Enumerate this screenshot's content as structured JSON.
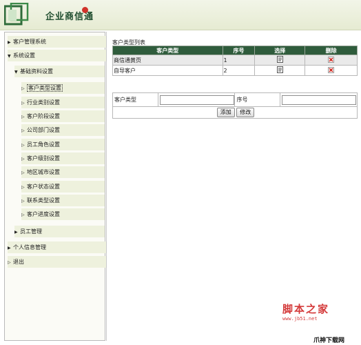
{
  "app": {
    "title": "企业商信通"
  },
  "sidebar": {
    "items": [
      {
        "label": "客户管理系统",
        "level": 0,
        "expanded": false
      },
      {
        "label": "系统设置",
        "level": 0,
        "expanded": true
      },
      {
        "label": "基础资料设置",
        "level": 1,
        "expanded": true
      },
      {
        "label": "客户类型设置",
        "level": 2,
        "selected": true
      },
      {
        "label": "行业类别设置",
        "level": 2
      },
      {
        "label": "客户阶段设置",
        "level": 2
      },
      {
        "label": "公司部门设置",
        "level": 2
      },
      {
        "label": "员工角色设置",
        "level": 2
      },
      {
        "label": "客户级别设置",
        "level": 2
      },
      {
        "label": "地区城市设置",
        "level": 2
      },
      {
        "label": "客户状态设置",
        "level": 2
      },
      {
        "label": "联系类型设置",
        "level": 2
      },
      {
        "label": "客户进度设置",
        "level": 2
      },
      {
        "label": "员工管理",
        "level": 1,
        "expanded": false
      },
      {
        "label": "个人信息管理",
        "level": 0,
        "expanded": false
      },
      {
        "label": "退出",
        "level": 0
      }
    ]
  },
  "list": {
    "title": "客户类型列表",
    "columns": [
      "客户类型",
      "序号",
      "选择",
      "删除"
    ],
    "rows": [
      {
        "type": "商信通黄页",
        "order": "1"
      },
      {
        "type": "自导客户",
        "order": "2"
      }
    ]
  },
  "form": {
    "type_label": "客户类型",
    "type_value": "",
    "order_label": "序号",
    "order_value": "",
    "add_label": "添加",
    "edit_label": "修改"
  },
  "watermark": {
    "brand": "脚本之家",
    "url": "www.jb51.net",
    "corner": "爪神下载网"
  },
  "colors": {
    "header_bg": "#e6ebd2",
    "table_header": "#2f5c3c",
    "delete_icon": "#d0322a",
    "watermark": "#d43a3a"
  }
}
